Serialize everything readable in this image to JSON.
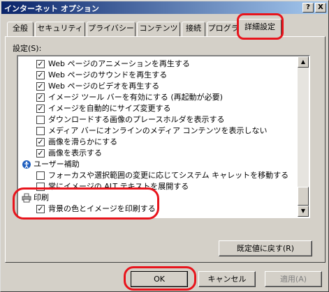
{
  "window": {
    "title": "インターネット オプション",
    "help_label": "?",
    "close_label": "X"
  },
  "tabs": [
    {
      "label": "全般"
    },
    {
      "label": "セキュリティ"
    },
    {
      "label": "プライバシー"
    },
    {
      "label": "コンテンツ"
    },
    {
      "label": "接続"
    },
    {
      "label": "プログラム"
    },
    {
      "label": "詳細設定",
      "active": true
    }
  ],
  "settings": {
    "group_label": "設定(S):",
    "items": [
      {
        "type": "checkbox",
        "checked": true,
        "label": "Web ページのアニメーションを再生する"
      },
      {
        "type": "checkbox",
        "checked": true,
        "label": "Web ページのサウンドを再生する"
      },
      {
        "type": "checkbox",
        "checked": true,
        "label": "Web ページのビデオを再生する"
      },
      {
        "type": "checkbox",
        "checked": true,
        "label": "イメージ ツール バーを有効にする (再起動が必要)"
      },
      {
        "type": "checkbox",
        "checked": true,
        "label": "イメージを自動的にサイズ変更する"
      },
      {
        "type": "checkbox",
        "checked": false,
        "label": "ダウンロードする画像のプレースホルダを表示する"
      },
      {
        "type": "checkbox",
        "checked": false,
        "label": "メディア バーにオンラインのメディア コンテンツを表示しない"
      },
      {
        "type": "checkbox",
        "checked": true,
        "label": "画像を滑らかにする"
      },
      {
        "type": "checkbox",
        "checked": true,
        "label": "画像を表示する"
      },
      {
        "type": "category",
        "icon": "accessibility-icon",
        "label": "ユーザー補助"
      },
      {
        "type": "checkbox",
        "checked": false,
        "label": "フォーカスや選択範囲の変更に応じてシステム キャレットを移動する"
      },
      {
        "type": "checkbox",
        "checked": false,
        "label": "常にイメージの ALT テキストを展開する"
      },
      {
        "type": "category",
        "icon": "printer-icon",
        "label": "印刷"
      },
      {
        "type": "checkbox",
        "checked": true,
        "label": "背景の色とイメージを印刷する"
      }
    ]
  },
  "buttons": {
    "reset": "既定値に戻す(R)",
    "ok": "OK",
    "cancel": "キャンセル",
    "apply": "適用(A)"
  },
  "colors": {
    "highlight": "#e8141c",
    "titlebar_start": "#0a246a",
    "titlebar_end": "#a6caf0"
  }
}
